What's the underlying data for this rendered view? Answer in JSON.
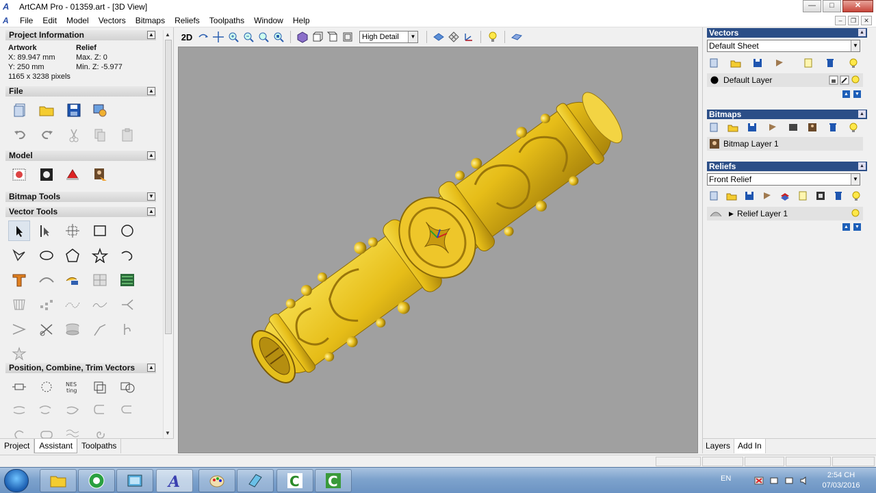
{
  "window": {
    "title": "ArtCAM Pro - 01359.art - [3D View]",
    "logo": "A"
  },
  "menu": [
    "File",
    "Edit",
    "Model",
    "Vectors",
    "Bitmaps",
    "Reliefs",
    "Toolpaths",
    "Window",
    "Help"
  ],
  "project_info": {
    "header": "Project Information",
    "artwork_label": "Artwork",
    "relief_label": "Relief",
    "x": "X: 89.947 mm",
    "y": "Y: 250 mm",
    "pixels": "1165 x 3238 pixels",
    "max_z": "Max. Z: 0",
    "min_z": "Min. Z: -5.977"
  },
  "sections": {
    "file": "File",
    "model": "Model",
    "bitmap_tools": "Bitmap Tools",
    "vector_tools": "Vector Tools",
    "position": "Position, Combine, Trim Vectors"
  },
  "left_tabs": [
    "Project",
    "Assistant",
    "Toolpaths"
  ],
  "view_toolbar": {
    "mode_2d": "2D",
    "detail": "High Detail"
  },
  "right": {
    "vectors": {
      "header": "Vectors",
      "sheet": "Default Sheet",
      "layer": "Default Layer"
    },
    "bitmaps": {
      "header": "Bitmaps",
      "layer": "Bitmap Layer 1"
    },
    "reliefs": {
      "header": "Reliefs",
      "relief": "Front Relief",
      "layer": "Relief Layer 1"
    }
  },
  "right_tabs": [
    "Layers",
    "Add In"
  ],
  "taskbar": {
    "lang": "EN",
    "time": "2:54 CH",
    "date": "07/03/2016"
  },
  "colors": {
    "relief": "#e8c020",
    "viewport_bg": "#a0a0a0",
    "panel_header": "#2b4e87"
  }
}
